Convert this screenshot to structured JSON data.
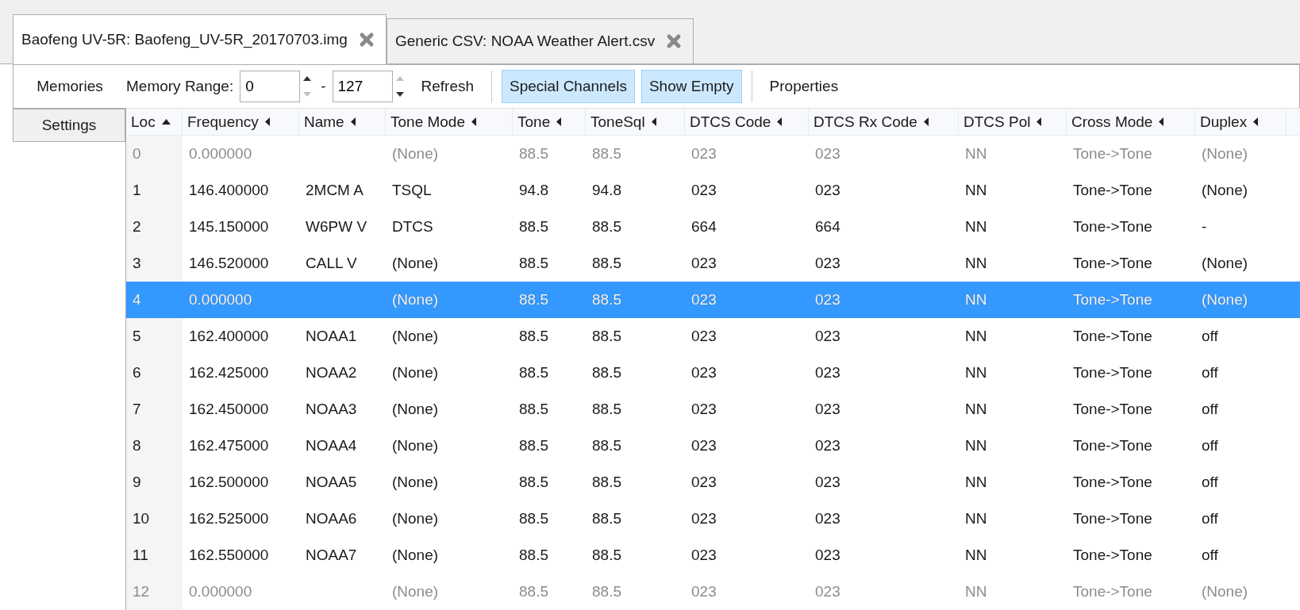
{
  "tabs": [
    {
      "label": "Baofeng UV-5R: Baofeng_UV-5R_20170703.img",
      "selected": true
    },
    {
      "label": "Generic CSV: NOAA Weather Alert.csv",
      "selected": false
    }
  ],
  "side_tabs": [
    {
      "label": "Memories",
      "selected": true
    },
    {
      "label": "Settings",
      "selected": false
    }
  ],
  "toolbar": {
    "range_label": "Memory Range:",
    "range_start": {
      "value": "0",
      "up_disabled": false,
      "down_disabled": true
    },
    "range_dash": "-",
    "range_end": {
      "value": "127",
      "up_disabled": true,
      "down_disabled": false
    },
    "refresh": "Refresh",
    "toggles": [
      {
        "label": "Special Channels",
        "on": true
      },
      {
        "label": "Show Empty",
        "on": true
      }
    ],
    "properties": "Properties"
  },
  "table": {
    "columns": [
      {
        "label": "Loc",
        "sorted": true
      },
      {
        "label": "Frequency",
        "sorted": false
      },
      {
        "label": "Name",
        "sorted": false
      },
      {
        "label": "Tone Mode",
        "sorted": false
      },
      {
        "label": "Tone",
        "sorted": false
      },
      {
        "label": "ToneSql",
        "sorted": false
      },
      {
        "label": "DTCS Code",
        "sorted": false
      },
      {
        "label": "DTCS Rx Code",
        "sorted": false
      },
      {
        "label": "DTCS Pol",
        "sorted": false
      },
      {
        "label": "Cross Mode",
        "sorted": false
      },
      {
        "label": "Duplex",
        "sorted": false
      }
    ],
    "rows": [
      {
        "cells": [
          "0",
          "0.000000",
          "",
          "(None)",
          "88.5",
          "88.5",
          "023",
          "023",
          "NN",
          "Tone->Tone",
          "(None)"
        ],
        "empty": true,
        "selected": false
      },
      {
        "cells": [
          "1",
          "146.400000",
          "2MCM A",
          "TSQL",
          "94.8",
          "94.8",
          "023",
          "023",
          "NN",
          "Tone->Tone",
          "(None)"
        ],
        "empty": false,
        "selected": false
      },
      {
        "cells": [
          "2",
          "145.150000",
          "W6PW V",
          "DTCS",
          "88.5",
          "88.5",
          "664",
          "664",
          "NN",
          "Tone->Tone",
          "-"
        ],
        "empty": false,
        "selected": false
      },
      {
        "cells": [
          "3",
          "146.520000",
          "CALL V",
          "(None)",
          "88.5",
          "88.5",
          "023",
          "023",
          "NN",
          "Tone->Tone",
          "(None)"
        ],
        "empty": false,
        "selected": false
      },
      {
        "cells": [
          "4",
          "0.000000",
          "",
          "(None)",
          "88.5",
          "88.5",
          "023",
          "023",
          "NN",
          "Tone->Tone",
          "(None)"
        ],
        "empty": true,
        "selected": true
      },
      {
        "cells": [
          "5",
          "162.400000",
          "NOAA1",
          "(None)",
          "88.5",
          "88.5",
          "023",
          "023",
          "NN",
          "Tone->Tone",
          "off"
        ],
        "empty": false,
        "selected": false
      },
      {
        "cells": [
          "6",
          "162.425000",
          "NOAA2",
          "(None)",
          "88.5",
          "88.5",
          "023",
          "023",
          "NN",
          "Tone->Tone",
          "off"
        ],
        "empty": false,
        "selected": false
      },
      {
        "cells": [
          "7",
          "162.450000",
          "NOAA3",
          "(None)",
          "88.5",
          "88.5",
          "023",
          "023",
          "NN",
          "Tone->Tone",
          "off"
        ],
        "empty": false,
        "selected": false
      },
      {
        "cells": [
          "8",
          "162.475000",
          "NOAA4",
          "(None)",
          "88.5",
          "88.5",
          "023",
          "023",
          "NN",
          "Tone->Tone",
          "off"
        ],
        "empty": false,
        "selected": false
      },
      {
        "cells": [
          "9",
          "162.500000",
          "NOAA5",
          "(None)",
          "88.5",
          "88.5",
          "023",
          "023",
          "NN",
          "Tone->Tone",
          "off"
        ],
        "empty": false,
        "selected": false
      },
      {
        "cells": [
          "10",
          "162.525000",
          "NOAA6",
          "(None)",
          "88.5",
          "88.5",
          "023",
          "023",
          "NN",
          "Tone->Tone",
          "off"
        ],
        "empty": false,
        "selected": false
      },
      {
        "cells": [
          "11",
          "162.550000",
          "NOAA7",
          "(None)",
          "88.5",
          "88.5",
          "023",
          "023",
          "NN",
          "Tone->Tone",
          "off"
        ],
        "empty": false,
        "selected": false
      },
      {
        "cells": [
          "12",
          "0.000000",
          "",
          "(None)",
          "88.5",
          "88.5",
          "023",
          "023",
          "NN",
          "Tone->Tone",
          "(None)"
        ],
        "empty": true,
        "selected": false
      }
    ]
  }
}
